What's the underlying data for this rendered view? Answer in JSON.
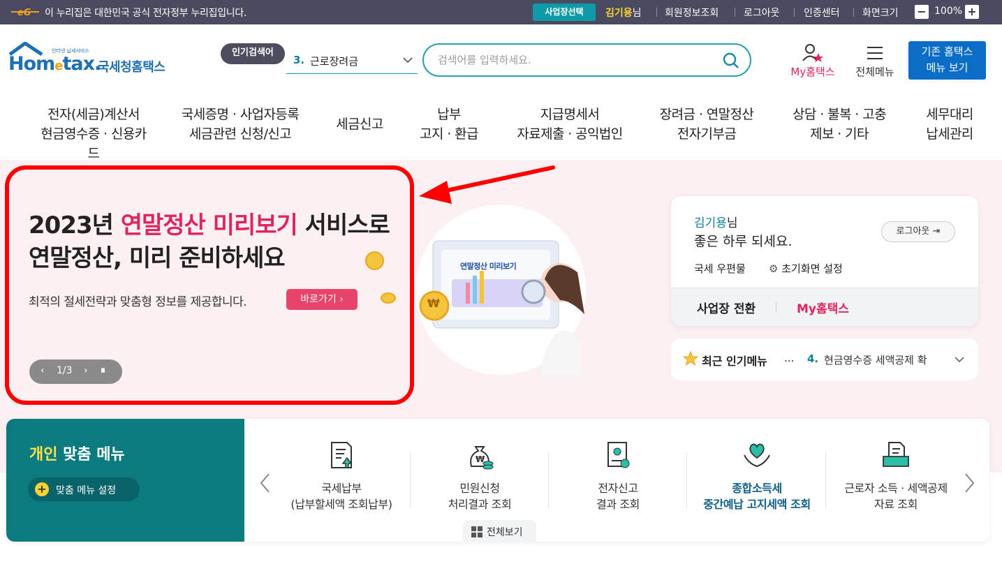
{
  "topbar": {
    "notice": "이 누리집은 대한민국 공식 전자정부 누리집입니다.",
    "business_select": "사업장선택",
    "user_name": "김기용",
    "user_suffix": "님",
    "member_info": "회원정보조회",
    "logout": "로그아웃",
    "cert_center": "인증센터",
    "screen_size": "화면크기",
    "zoom_minus": "−",
    "zoom_level": "100%",
    "zoom_plus": "+"
  },
  "header": {
    "logo_tagline": "인터넷 납세서비스",
    "logo_text_home": "Hom",
    "logo_text_e": "e",
    "logo_text_tax": "tax.",
    "logo_kr": "국세청홈택스",
    "popular_badge": "인기검색어",
    "popular_num": "3.",
    "popular_term": "근로장려금",
    "search_placeholder": "검색어를 입력하세요.",
    "myhometax": "My홈택스",
    "all_menu": "전체메뉴",
    "old_home_line1": "기존 홈택스",
    "old_home_line2": "메뉴 보기"
  },
  "gnb": [
    {
      "l1": "전자(세금)계산서",
      "l2": "현금영수증 · 신용카드"
    },
    {
      "l1": "국세증명 · 사업자등록",
      "l2": "세금관련 신청/신고"
    },
    {
      "l1": "세금신고",
      "l2": ""
    },
    {
      "l1": "납부",
      "l2": "고지 · 환급"
    },
    {
      "l1": "지급명세서",
      "l2": "자료제출 · 공익법인"
    },
    {
      "l1": "장려금 · 연말정산",
      "l2": "전자기부금"
    },
    {
      "l1": "상담 · 불복 · 고충",
      "l2": "제보 · 기타"
    },
    {
      "l1": "세무대리",
      "l2": "납세관리"
    }
  ],
  "hero": {
    "title1_pre": "2023년 ",
    "title1_hl": "연말정산 미리보기",
    "title1_post": " 서비스로",
    "title2": "연말정산, 미리 준비하세요",
    "desc": "최적의 절세전략과 맞춤형 정보를 제공합니다.",
    "go": "바로가기",
    "pager": "1/3",
    "illus_screen": "연말정산 미리보기",
    "coin_symbol": "₩"
  },
  "login": {
    "name": "김기용",
    "suffix": "님",
    "greeting": "좋은 하루 되세요.",
    "logout": "로그아웃",
    "mailbox": "국세 우편물",
    "home_setting": "초기화면 설정",
    "switch_biz": "사업장 전환",
    "myhometax": "My홈택스"
  },
  "popular_menu": {
    "title": "최근 인기메뉴",
    "ellipsis": "...",
    "num": "4.",
    "item": "현금영수증 세액공제 확"
  },
  "custom_menu": {
    "title_hl": "개인",
    "title_rest": " 맞춤 메뉴",
    "setting": "맞춤 메뉴 설정",
    "all_view": "전체보기",
    "items": [
      {
        "l1": "국세납부",
        "l2": "(납부할세액 조회납부)",
        "icon": "tax-payment-icon",
        "em": false
      },
      {
        "l1": "민원신청",
        "l2": "처리결과 조회",
        "icon": "money-bag-icon",
        "em": false
      },
      {
        "l1": "전자신고",
        "l2": "결과 조회",
        "icon": "certificate-icon",
        "em": false
      },
      {
        "l1": "종합소득세",
        "l2": "중간예납 고지세액 조회",
        "icon": "heart-hands-icon",
        "em": true
      },
      {
        "l1": "근로자 소득 · 세액공제",
        "l2": "자료 조회",
        "icon": "document-tray-icon",
        "em": false
      }
    ]
  },
  "colors": {
    "accent_teal": "#0e9ba7",
    "brand_pink": "#e0245e",
    "brand_blue": "#0a6ec7",
    "highlight_red": "#ff0000"
  }
}
